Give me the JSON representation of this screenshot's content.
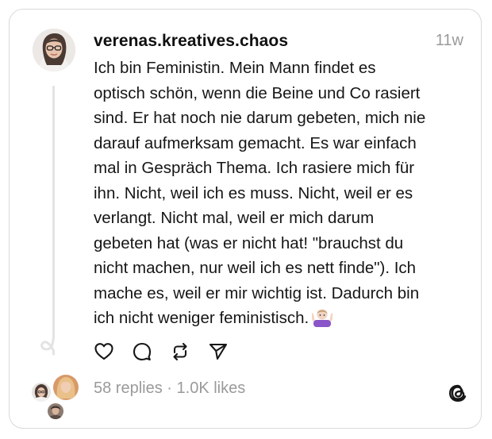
{
  "post": {
    "username": "verenas.kreatives.chaos",
    "timestamp": "11w",
    "text": "Ich bin Feministin. Mein Mann findet es\noptisch schön, wenn die Beine und Co rasiert\nsind. Er hat noch nie darum gebeten, mich nie\ndarauf aufmerksam gemacht. Es war einfach\nmal in Gespräch Thema. Ich rasiere mich für\nihn. Nicht, weil ich es muss. Nicht, weil er es\nverlangt. Nicht mal, weil er mich darum\ngebeten hat (was er nicht hat! \"brauchst du\nnicht machen, nur weil ich es nett finde\"). Ich\nmache es, weil er mir wichtig ist. Dadurch bin\nich nicht weniger feministisch.",
    "emoji": "person-shrugging-emoji"
  },
  "actions": {
    "like_icon": "heart-icon",
    "reply_icon": "comment-icon",
    "repost_icon": "repost-icon",
    "share_icon": "send-icon"
  },
  "stats": {
    "replies": "58 replies",
    "separator": "·",
    "likes": "1.0K likes"
  },
  "colors": {
    "text": "#161616",
    "muted": "#9a9a9a",
    "border": "#d9d9d9",
    "thread_line": "#e3e3e3"
  }
}
